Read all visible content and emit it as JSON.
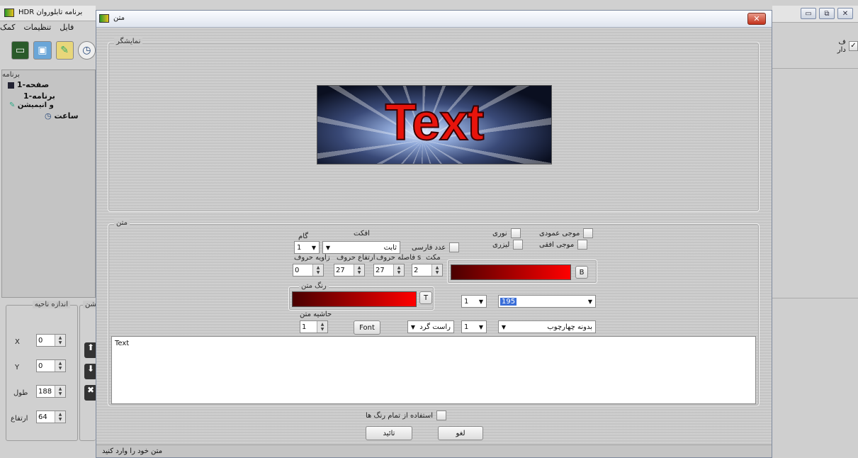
{
  "main_window": {
    "title": "برنامه تابلوروان HDR",
    "menu": [
      "فایل",
      "تنظیمات",
      "کمک"
    ],
    "toolbar_icons": [
      "monitor-icon",
      "window-icon",
      "paint-icon",
      "clock-icon"
    ],
    "program_section_label": "برنامه",
    "tree": {
      "page": "صفحه-1",
      "program": "برنامه-1",
      "animation": "و انیمیشن",
      "clock": "ساعت"
    },
    "area_group": {
      "label": "اندازه ناحیه",
      "x_label": "X",
      "x_value": "0",
      "y_label": "Y",
      "y_value": "0",
      "width_label": "طول",
      "width_value": "188",
      "height_label": "ارتفاع",
      "height_value": "64"
    },
    "second_group_label": "یشن",
    "right_checkbox_label": "ف دار",
    "right_checkbox_checked": true
  },
  "dialog": {
    "title": "متن",
    "close_glyph": "✕",
    "preview_frame_label": "نمایشگر",
    "preview_text": "Text",
    "text_frame_label": "متن",
    "effects": {
      "vertical_wave": "موجی عمودی",
      "horizontal_wave": "موجی افقی",
      "neon": "نوری",
      "laser": "لیزری"
    },
    "effect_label": "افکت",
    "effect_value": "ثابت",
    "step_label": "گام",
    "step_value": "1",
    "persian_number_label": "عدد فارسی",
    "pause_label": "مکث",
    "seconds_label": "s",
    "letter_spacing_label": "فاصله حروف",
    "letter_height_label": "ارتفاع حروف",
    "letter_angle_label": "زاویه حروف",
    "pause_value": "2",
    "letter_spacing_value": "27",
    "letter_height_value": "27",
    "letter_angle_value": "0",
    "bg_color_button": "B",
    "text_color_label": "رنگ متن",
    "text_color_button": "T",
    "font_size_value": "1",
    "font_name_value": "195",
    "text_border_label": "حاشیه متن",
    "text_border_value": "1",
    "font_button": "Font",
    "align_value": "راست گرد",
    "line_value": "1",
    "frame_value": "بدونه چهارچوب",
    "text_content": "Text",
    "use_all_colors_label": "استفاده از تمام رنگ ها",
    "ok_button": "تائید",
    "cancel_button": "لغو",
    "status_text": "متن خود را وارد کنید",
    "colors": {
      "text_red": "#e8140c",
      "bg_gradient_dark": "#4a0000",
      "bg_gradient_light": "#ff0000"
    }
  }
}
